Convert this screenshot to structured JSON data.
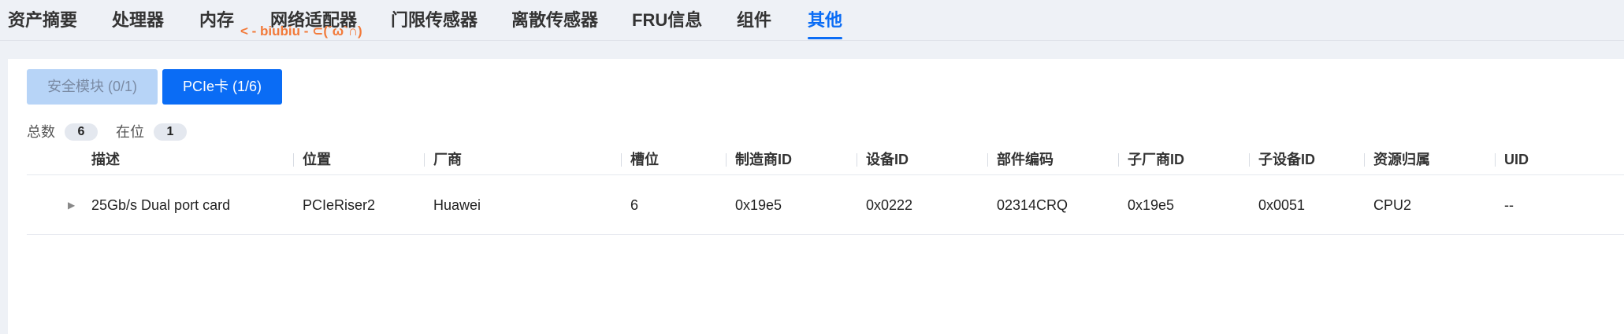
{
  "tabs": [
    {
      "label": "资产摘要"
    },
    {
      "label": "处理器"
    },
    {
      "label": "内存"
    },
    {
      "label": "网络适配器"
    },
    {
      "label": "门限传感器"
    },
    {
      "label": "离散传感器"
    },
    {
      "label": "FRU信息"
    },
    {
      "label": "组件"
    },
    {
      "label": "其他",
      "active": true
    }
  ],
  "overlay_text": "< - biubiu - ⊂(´ω`∩)",
  "sub_buttons": {
    "security_module": "安全模块 (0/1)",
    "pcie_card": "PCIe卡 (1/6)"
  },
  "stats": {
    "total_label": "总数",
    "total_value": "6",
    "present_label": "在位",
    "present_value": "1"
  },
  "table": {
    "columns": [
      "描述",
      "位置",
      "厂商",
      "槽位",
      "制造商ID",
      "设备ID",
      "部件编码",
      "子厂商ID",
      "子设备ID",
      "资源归属",
      "UID"
    ],
    "rows": [
      [
        "25Gb/s Dual port card",
        "PCIeRiser2",
        "Huawei",
        "6",
        "0x19e5",
        "0x0222",
        "02314CRQ",
        "0x19e5",
        "0x0051",
        "CPU2",
        "--"
      ]
    ]
  },
  "icons": {
    "row_expander": "triangle-right-icon"
  },
  "colors": {
    "accent": "#0a6cf5",
    "overlay": "#f27a3a",
    "disabled_button": "#b7d4f7"
  }
}
